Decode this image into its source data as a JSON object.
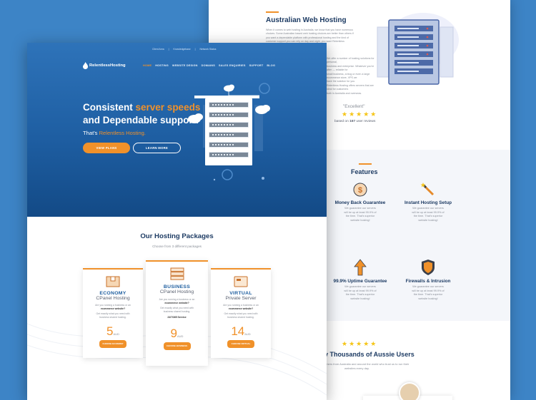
{
  "back": {
    "section_title": "Australian Web Hosting",
    "intro_lines": [
      "When it comes to web hosting in Australia, we know that you have numerous",
      "choices. Some Australian based web hosting choices are better than others if",
      "you want a dependable platform with professional hosting and the kind of",
      "customer support you can rely on day and night, you want Relentless",
      "Hosting."
    ],
    "body_lines": [
      "We offer a number of hosting solutions for personal,",
      "business and enterprise. Whatever you're after — reliable for",
      "small business, a blog or even a large ecommerce store, VPS we",
      "have the solution for you.",
      "",
      "Relentless Hosting offers servers that are ideal for customers",
      "both in Australia and overseas."
    ],
    "rating_label": "\"Excellent\"",
    "rating_stars": "★★★★★",
    "reviews_prefix": "based on ",
    "reviews_count": "167",
    "reviews_suffix": " user reviews",
    "features_title": "Features",
    "features": [
      {
        "icon": "dollar-coin-icon",
        "title": "Money Back Guarantee",
        "desc": [
          "We guarantee our servers",
          "will be up at least 99.9% of",
          "the time. That's superior",
          "website hosting!"
        ]
      },
      {
        "icon": "magic-wand-icon",
        "title": "Instant Hosting Setup",
        "desc": [
          "We guarantee our servers",
          "will be up at least 99.9% of",
          "the time. That's superior",
          "website hosting!"
        ]
      },
      {
        "icon": "arrow-up-icon",
        "title": "99.9% Uptime Guarantee",
        "desc": [
          "We guarantee our servers",
          "will be up at least 99.9% of",
          "the time. That's superior",
          "website hosting!"
        ]
      },
      {
        "icon": "shield-icon",
        "title": "Firewalls & Intrusion",
        "desc": [
          "We guarantee our servers",
          "will be up at least 99.9% of",
          "the time. That's superior",
          "website hosting!"
        ]
      }
    ],
    "trusted_stars": "★★★★★",
    "trusted_title": "y Thousands of Aussie Users",
    "trusted_lines": [
      "omers from Australia and around the world who trust us to run their",
      "websites every day."
    ]
  },
  "front": {
    "topbar": [
      "Client Area",
      "Knowledgebase",
      "Network Status"
    ],
    "logo_text": "RelentlessHosting",
    "nav": [
      "HOME",
      "HOSTING",
      "WEBSITE DESIGN",
      "DOMAINS",
      "SALES ENQUIRIES",
      "SUPPORT",
      "BLOG"
    ],
    "hero": {
      "line1_plain": "Consistent ",
      "line1_accent": "server speeds",
      "line2": "and Dependable support.",
      "tagline_plain": "That's ",
      "tagline_accent": "Relentless Hosting.",
      "btn_primary": "VIEW PLANS",
      "btn_secondary": "LEARN MORE"
    },
    "packages_title": "Our Hosting Packages",
    "packages_subtitle": "Choose from 3 different packages",
    "packages": [
      {
        "name": "ECONOMY",
        "sub": "CPanel Hosting",
        "desc1": [
          "Are you running a business or an",
          "ecommerce website?"
        ],
        "desc2": [
          "Get exactly what you need with",
          "business shared hosting."
        ],
        "extra": "",
        "price": "5",
        "currency": "AUD",
        "btn": "CHOOSE ECONOMY"
      },
      {
        "name": "BUSINESS",
        "sub": "CPanel Hosting",
        "desc1": [
          "Are you running a business or an",
          "ecommerce website?"
        ],
        "desc2": [
          "Get exactly what you need with",
          "business shared hosting."
        ],
        "extra": "24/7/365 Service",
        "price": "9",
        "currency": "AUD",
        "btn": "CHOOSE BUSINESS"
      },
      {
        "name": "VIRTUAL",
        "sub": "Private Server",
        "desc1": [
          "Are you running a business or an",
          "ecommerce website?"
        ],
        "desc2": [
          "Get exactly what you need with",
          "business shared hosting."
        ],
        "extra": "",
        "price": "14",
        "currency": "AUD",
        "btn": "CHOOSE VIRTUAL"
      }
    ]
  },
  "colors": {
    "background": "#3d84c6",
    "accent": "#f0912a",
    "navy": "#1d3b63",
    "hero_blue": "#1e5ea2",
    "star": "#f5c518"
  }
}
